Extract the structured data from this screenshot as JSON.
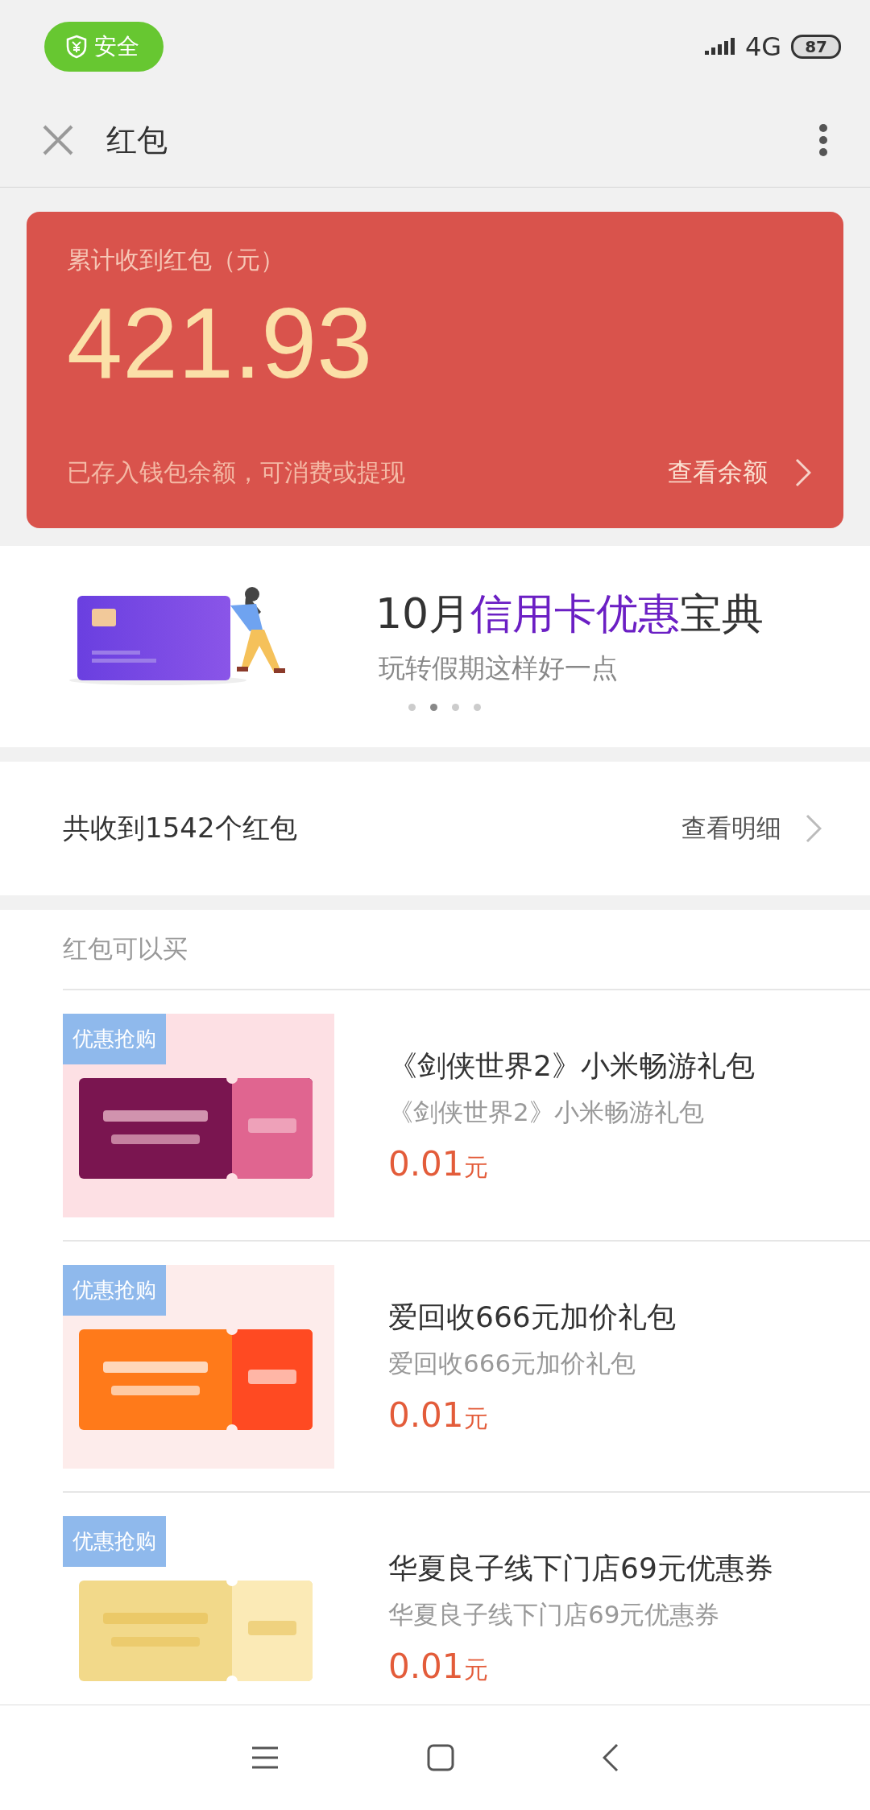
{
  "status_bar": {
    "safe_badge": "安全",
    "network": "4G",
    "battery": "87"
  },
  "header": {
    "title": "红包"
  },
  "summary": {
    "label": "累计收到红包（元）",
    "amount": "421.93",
    "note": "已存入钱包余额，可消费或提现",
    "link": "查看余额"
  },
  "banner": {
    "title_parts": [
      {
        "text": "10月",
        "highlight": false
      },
      {
        "text": "信用卡优惠",
        "highlight": true
      },
      {
        "text": "宝典",
        "highlight": false
      }
    ],
    "subtitle": "玩转假期这样好一点",
    "dots": [
      {
        "selected": false
      },
      {
        "selected": true
      },
      {
        "selected": false
      },
      {
        "selected": false
      }
    ]
  },
  "count_row": {
    "text": "共收到1542个红包",
    "link": "查看明细"
  },
  "shop": {
    "heading": "红包可以买",
    "items": [
      {
        "badge": "优惠抢购",
        "title": "《剑侠世界2》小米畅游礼包",
        "subtitle": "《剑侠世界2》小米畅游礼包",
        "price": "0.01",
        "unit": "元"
      },
      {
        "badge": "优惠抢购",
        "title": "爱回收666元加价礼包",
        "subtitle": "爱回收666元加价礼包",
        "price": "0.01",
        "unit": "元"
      },
      {
        "badge": "优惠抢购",
        "title": "华夏良子线下门店69元优惠券",
        "subtitle": "华夏良子线下门店69元优惠券",
        "price": "0.01",
        "unit": "元"
      }
    ]
  }
}
